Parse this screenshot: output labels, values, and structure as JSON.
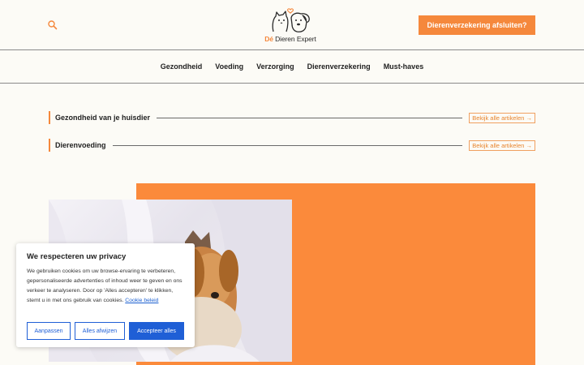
{
  "header": {
    "logo_prefix": "Dé",
    "logo_name": "Dieren Expert",
    "cta_label": "Dierenverzekering afsluiten?"
  },
  "nav": {
    "items": [
      "Gezondheid",
      "Voeding",
      "Verzorging",
      "Dierenverzekering",
      "Must-haves"
    ]
  },
  "sections": [
    {
      "title": "Gezondheid van je huisdier",
      "link": "Bekijk alle artikelen →"
    },
    {
      "title": "Dierenvoeding",
      "link": "Bekijk alle artikelen →"
    }
  ],
  "cookie": {
    "title": "We respecteren uw privacy",
    "text": "We gebruiken cookies om uw browse-ervaring te verbeteren, gepersonaliseerde advertenties of inhoud weer te geven en ons verkeer te analyseren. Door op 'Alles accepteren' te klikken, stemt u in met ons gebruik van cookies.",
    "policy_link": "Cookie beleid",
    "buttons": [
      "Aanpassen",
      "Alles afwijzen",
      "Accepteer alles"
    ]
  },
  "colors": {
    "accent": "#f5883c",
    "cookie_blue": "#1f5fd6"
  },
  "icons": {
    "search": "search-icon"
  }
}
